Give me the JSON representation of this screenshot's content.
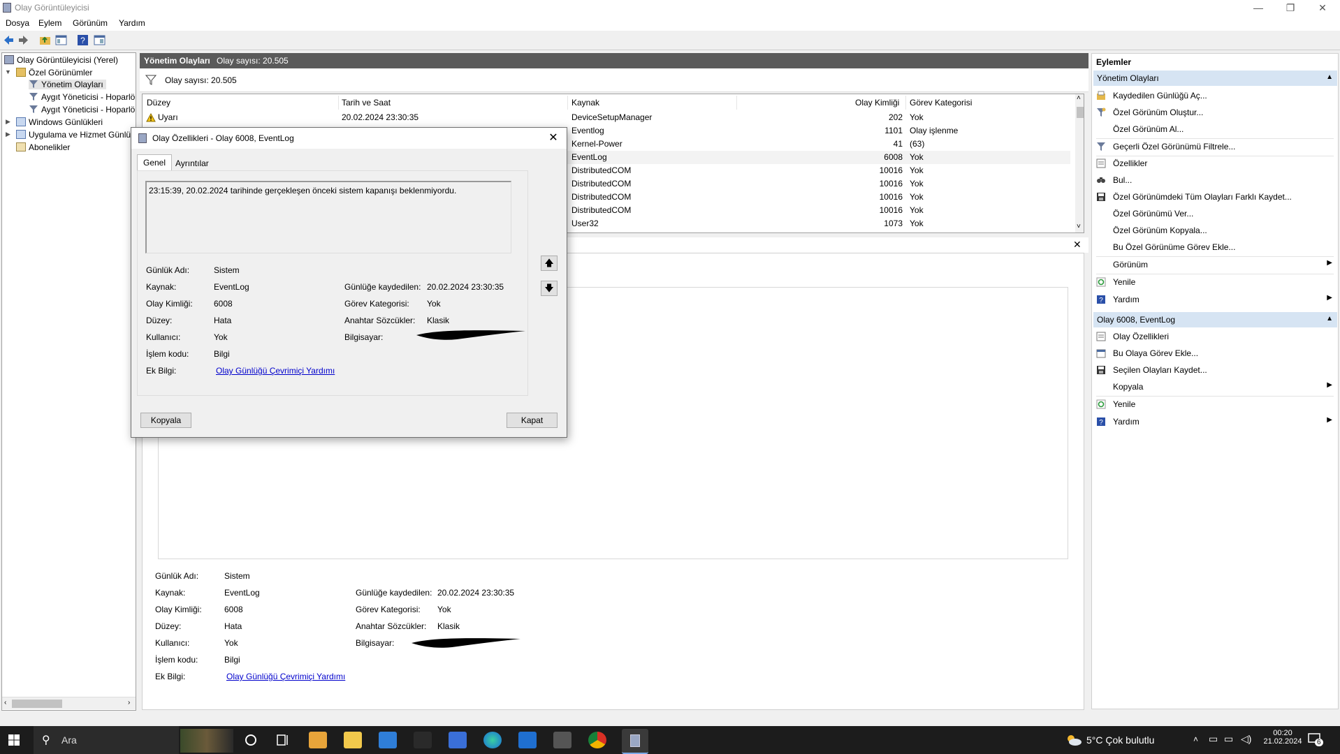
{
  "window": {
    "title": "Olay Görüntüleyicisi",
    "controls": {
      "minimize": "—",
      "restore": "❐",
      "close": "✕"
    }
  },
  "menu": [
    "Dosya",
    "Eylem",
    "Görünüm",
    "Yardım"
  ],
  "tree": {
    "root": "Olay Görüntüleyicisi (Yerel)",
    "custom_views": "Özel Görünümler",
    "admin_events": "Yönetim Olayları",
    "device_mgr_1": "Aygıt Yöneticisi - Hoparlö",
    "device_mgr_2": "Aygıt Yöneticisi - Hoparlö",
    "windows_logs": "Windows Günlükleri",
    "app_service_logs": "Uygulama ve Hizmet Günlü",
    "subscriptions": "Abonelikler"
  },
  "center": {
    "header_title": "Yönetim Olayları",
    "header_count": "Olay sayısı: 20.505",
    "filter_count": "Olay sayısı: 20.505",
    "columns": {
      "level": "Düzey",
      "datetime": "Tarih ve Saat",
      "source": "Kaynak",
      "event_id": "Olay Kimliği",
      "category": "Görev Kategorisi"
    },
    "rows": [
      {
        "level": "Uyarı",
        "datetime": "20.02.2024 23:30:35",
        "source": "DeviceSetupManager",
        "event_id": "202",
        "category": "Yok"
      },
      {
        "level": "",
        "datetime": "",
        "source": "Eventlog",
        "event_id": "1101",
        "category": "Olay işlenme"
      },
      {
        "level": "",
        "datetime": "",
        "source": "Kernel-Power",
        "event_id": "41",
        "category": "(63)"
      },
      {
        "level": "",
        "datetime": "",
        "source": "EventLog",
        "event_id": "6008",
        "category": "Yok"
      },
      {
        "level": "",
        "datetime": "",
        "source": "DistributedCOM",
        "event_id": "10016",
        "category": "Yok"
      },
      {
        "level": "",
        "datetime": "",
        "source": "DistributedCOM",
        "event_id": "10016",
        "category": "Yok"
      },
      {
        "level": "",
        "datetime": "",
        "source": "DistributedCOM",
        "event_id": "10016",
        "category": "Yok"
      },
      {
        "level": "",
        "datetime": "",
        "source": "DistributedCOM",
        "event_id": "10016",
        "category": "Yok"
      },
      {
        "level": "",
        "datetime": "",
        "source": "User32",
        "event_id": "1073",
        "category": "Yok"
      }
    ]
  },
  "detail": {
    "close": "✕",
    "log_name_label": "Günlük Adı:",
    "log_name": "Sistem",
    "source_label": "Kaynak:",
    "source": "EventLog",
    "event_id_label": "Olay Kimliği:",
    "event_id": "6008",
    "level_label": "Düzey:",
    "level": "Hata",
    "user_label": "Kullanıcı:",
    "user": "Yok",
    "opcode_label": "İşlem kodu:",
    "opcode": "Bilgi",
    "more_info_label": "Ek Bilgi:",
    "more_info_link": "Olay Günlüğü Çevrimiçi Yardımı",
    "logged_label": "Günlüğe kaydedilen:",
    "logged": "20.02.2024 23:30:35",
    "category_label": "Görev Kategorisi:",
    "category": "Yok",
    "keywords_label": "Anahtar Sözcükler:",
    "keywords": "Klasik",
    "computer_label": "Bilgisayar:"
  },
  "dialog": {
    "title": "Olay Özellikleri - Olay 6008, EventLog",
    "close": "✕",
    "tabs": [
      "Genel",
      "Ayrıntılar"
    ],
    "message": "23:15:39, 20.02.2024 tarihinde gerçekleşen önceki sistem kapanışı beklenmiyordu.",
    "copy_button": "Kopyala",
    "close_button": "Kapat",
    "nav_up": "🡅",
    "nav_down": "🡇"
  },
  "actions": {
    "header": "Eylemler",
    "section1": "Yönetim Olayları",
    "section1_items": [
      {
        "label": "Kaydedilen Günlüğü Aç...",
        "icon": "open-log-icon"
      },
      {
        "label": "Özel Görünüm Oluştur...",
        "icon": "filter-icon"
      },
      {
        "label": "Özel Görünüm Al...",
        "icon": ""
      },
      {
        "label": "Geçerli Özel Görünümü Filtrele...",
        "icon": "filter-icon"
      },
      {
        "label": "Özellikler",
        "icon": "properties-icon"
      },
      {
        "label": "Bul...",
        "icon": "find-icon"
      },
      {
        "label": "Özel Görünümdeki Tüm Olayları Farklı Kaydet...",
        "icon": "save-icon"
      },
      {
        "label": "Özel Görünümü Ver...",
        "icon": ""
      },
      {
        "label": "Özel Görünüm Kopyala...",
        "icon": ""
      },
      {
        "label": "Bu Özel Görünüme Görev Ekle...",
        "icon": ""
      },
      {
        "label": "Görünüm",
        "icon": ""
      },
      {
        "label": "Yenile",
        "icon": "refresh-icon"
      },
      {
        "label": "Yardım",
        "icon": "help-icon"
      }
    ],
    "section2": "Olay 6008, EventLog",
    "section2_items": [
      {
        "label": "Olay Özellikleri",
        "icon": "properties-icon"
      },
      {
        "label": "Bu Olaya Görev Ekle...",
        "icon": "task-icon"
      },
      {
        "label": "Seçilen Olayları Kaydet...",
        "icon": "save-icon"
      },
      {
        "label": "Kopyala",
        "icon": ""
      },
      {
        "label": "Yenile",
        "icon": "refresh-icon"
      },
      {
        "label": "Yardım",
        "icon": "help-icon"
      }
    ],
    "submenu_glyph": "▶",
    "collapse_glyph": "▲"
  },
  "taskbar": {
    "search_placeholder": "Ara",
    "weather": "5°C  Çok bulutlu",
    "time": "00:20",
    "date": "21.02.2024",
    "notification_count": "6"
  },
  "colors": {
    "section_bg": "#d6e4f3",
    "header_dark": "#5a5a5a",
    "link": "#0000cc",
    "taskbar": "#1c1c1c"
  }
}
